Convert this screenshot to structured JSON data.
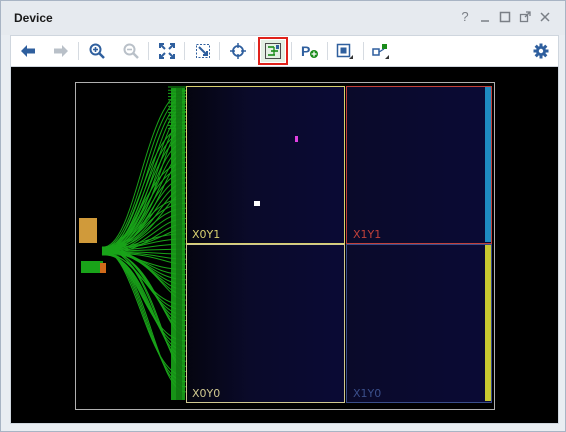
{
  "panel": {
    "title": "Device"
  },
  "window_controls": [
    "help-icon",
    "minimize-icon",
    "restore-icon",
    "float-icon",
    "close-icon"
  ],
  "toolbar": {
    "buttons": [
      {
        "icon": "back-arrow-icon",
        "enabled": true
      },
      {
        "icon": "forward-arrow-icon",
        "enabled": false
      },
      {
        "icon": "zoom-in-icon",
        "enabled": true
      },
      {
        "icon": "zoom-out-icon",
        "enabled": false
      },
      {
        "icon": "zoom-fit-icon",
        "enabled": true
      },
      {
        "icon": "zoom-to-selected-icon",
        "enabled": true
      },
      {
        "icon": "auto-fit-selection-icon",
        "enabled": true
      },
      {
        "icon": "routing-resources-icon",
        "enabled": true,
        "highlighted": true
      },
      {
        "icon": "pblock-add-icon",
        "enabled": true
      },
      {
        "icon": "draw-pblock-icon",
        "enabled": true
      },
      {
        "icon": "draw-connection-icon",
        "enabled": true
      },
      {
        "icon": "settings-gear-icon",
        "enabled": true
      }
    ],
    "highlight_color": "#e0221b"
  },
  "device": {
    "clock_regions": [
      {
        "label": "X0Y1",
        "color": "#d8d070"
      },
      {
        "label": "X1Y1",
        "color": "#c0403a"
      },
      {
        "label": "X0Y0",
        "color": "#d0c890"
      },
      {
        "label": "X1Y0",
        "color": "#3a4e8a"
      }
    ],
    "routing_color": "#19a319",
    "background": "#000000"
  }
}
